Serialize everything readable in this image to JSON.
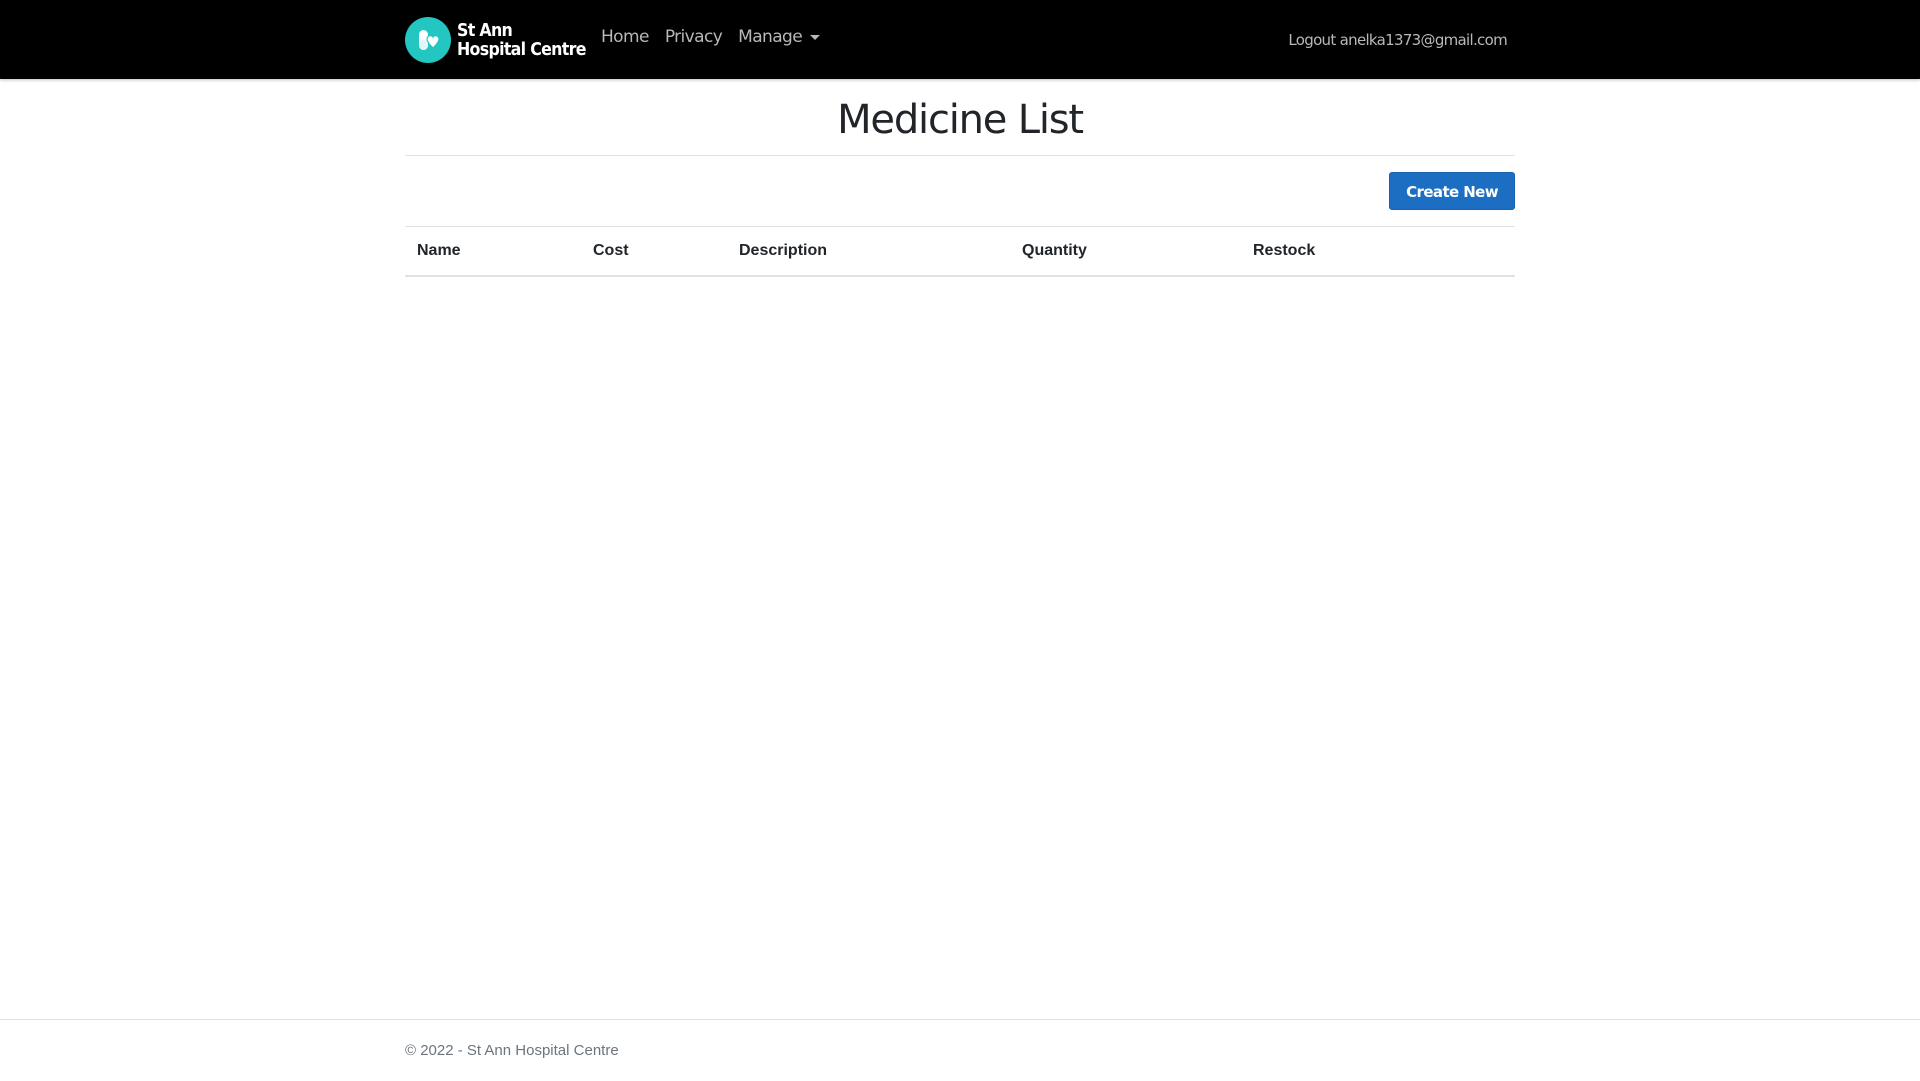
{
  "navbar": {
    "brand_line1": "St Ann",
    "brand_line2": "Hospital Centre",
    "links": {
      "home": "Home",
      "privacy": "Privacy",
      "manage": "Manage"
    },
    "logout_label": "Logout",
    "user_email": "anelka1373@gmail.com",
    "logo_color": "#23c6c0"
  },
  "page": {
    "title": "Medicine List",
    "create_button": "Create New"
  },
  "table": {
    "columns": [
      "Name",
      "Cost",
      "Description",
      "Quantity",
      "Restock"
    ],
    "rows": []
  },
  "footer": {
    "text": "© 2022 - St Ann Hospital Centre"
  },
  "colors": {
    "navbar_bg": "#000000",
    "primary": "#1b6ec2"
  }
}
